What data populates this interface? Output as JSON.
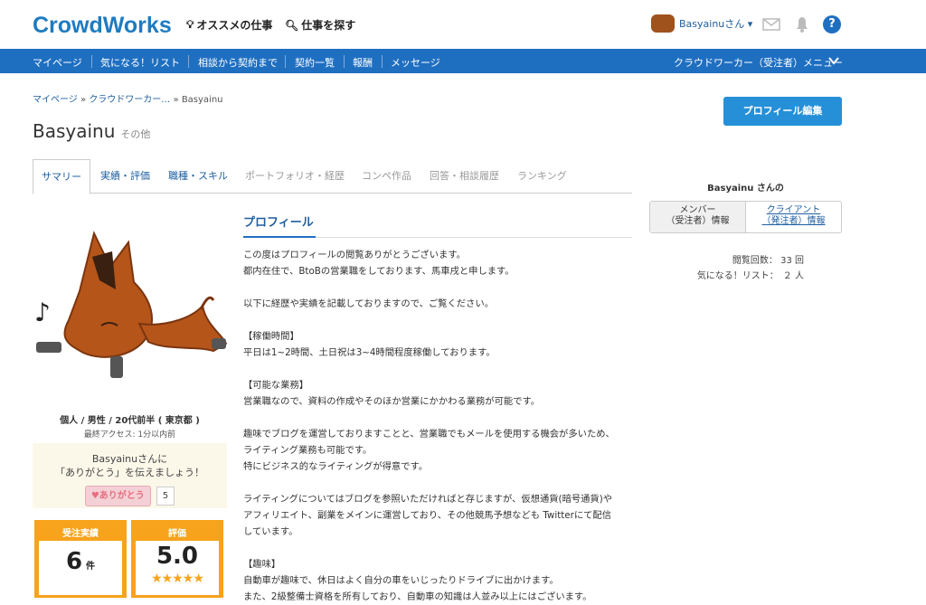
{
  "header": {
    "logo": "CrowdWorks",
    "recommended": "オススメの仕事",
    "search": "仕事を探す",
    "username": "Basyainuさん ▾"
  },
  "nav": {
    "items": [
      "マイページ",
      "気になる！リスト",
      "相談から契約まで",
      "契約一覧",
      "報酬",
      "メッセージ"
    ],
    "menu": "クラウドワーカー（受注者）メニュー"
  },
  "breadcrumb": {
    "a": "マイページ",
    "b": "クラウドワーカー…",
    "c": "Basyainu"
  },
  "page": {
    "title": "Basyainu",
    "subtitle": "その他",
    "edit": "プロフィール編集"
  },
  "tabs": [
    "サマリー",
    "実績・評価",
    "職種・スキル",
    "ポートフォリオ・経歴",
    "コンペ作品",
    "回答・相談履歴",
    "ランキング"
  ],
  "side": {
    "name": "Basyainu さんの",
    "member": "メンバー\n（受注者）情報",
    "client": "クライアント\n（発注者）情報",
    "views": "閲覧回数： 33 回",
    "favs": "気になる！リスト：　２ 人"
  },
  "user": {
    "info": "個人 / 男性 / 20代前半 ( 東京都 )",
    "last": "最終アクセス: 1分以内前"
  },
  "thanks": {
    "line1": "Basyainuさんに",
    "line2": "「ありがとう」を伝えましょう！",
    "btn": "♥ありがとう",
    "count": "5"
  },
  "boxes": {
    "orders_label": "受注実績",
    "orders": "6",
    "unit": "件",
    "rating_label": "評価",
    "rating": "5.0",
    "stars": "★★★★★"
  },
  "profile": {
    "heading": "プロフィール",
    "text": "この度はプロフィールの閲覧ありがとうございます。\n都内在住で、BtoBの営業職をしております、馬車戌と申します。\n\n以下に経歴や実績を記載しておりますので、ご覧ください。\n\n【稼働時間】\n平日は1~2時間、土日祝は3~4時間程度稼働しております。\n\n【可能な業務】\n営業職なので、資料の作成やそのほか営業にかかわる業務が可能です。\n\n趣味でブログを運営しておりますことと、営業職でもメールを使用する機会が多いため、\nライティング業務も可能です。\n特にビジネス的なライティングが得意です。\n\nライティングについてはブログを参照いただければと存じますが、仮想通貨(暗号通貨)や\nアフィリエイト、副業をメインに運営しており、その他競馬予想なども Twitterにて配信\nしています。\n\n【趣味】\n自動車が趣味で、休日はよく自分の車をいじったりドライブに出かけます。\nまた、2級整備士資格を所有しており、自動車の知識は人並み以上にはございます。"
  }
}
